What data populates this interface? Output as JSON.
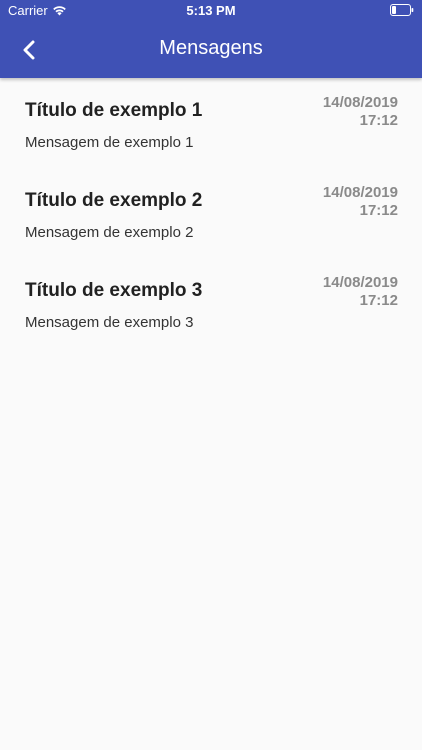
{
  "status_bar": {
    "carrier": "Carrier",
    "time": "5:13 PM",
    "wifi_icon": "wifi-icon",
    "battery_icon": "battery-icon"
  },
  "nav": {
    "title": "Mensagens",
    "back_icon": "chevron-left-icon",
    "background_color": "#3f51b5"
  },
  "messages": [
    {
      "title": "Título de exemplo 1",
      "body": "Mensagem de exemplo 1",
      "date": "14/08/2019",
      "time": "17:12"
    },
    {
      "title": "Título de exemplo 2",
      "body": "Mensagem de exemplo 2",
      "date": "14/08/2019",
      "time": "17:12"
    },
    {
      "title": "Título de exemplo 3",
      "body": "Mensagem de exemplo 3",
      "date": "14/08/2019",
      "time": "17:12"
    }
  ]
}
